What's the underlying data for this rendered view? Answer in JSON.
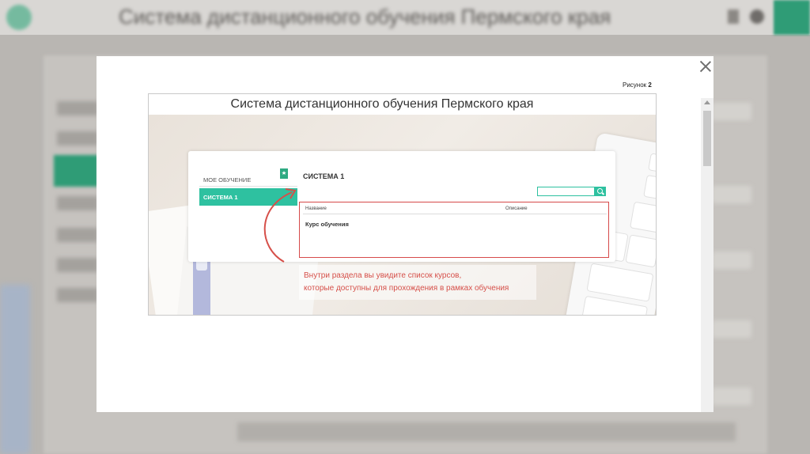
{
  "background": {
    "title": "Система дистанционного обучения Пермского края"
  },
  "modal": {
    "caption_prefix": "Рисунок",
    "caption_number": "2"
  },
  "slide": {
    "title": "Система дистанционного обучения Пермского края",
    "menu": {
      "my_learning": "МОЕ ОБУЧЕНИЕ",
      "active_item": "СИСТЕМА 1"
    },
    "section_title": "СИСТЕМА 1",
    "table": {
      "columns": [
        "Название",
        "Описание"
      ],
      "rows": [
        {
          "name": "Курс обучения"
        }
      ]
    },
    "note": [
      "Внутри раздела вы увидите список курсов,",
      "которые доступны для прохождения в рамках обучения"
    ]
  },
  "colors": {
    "accent": "#2ec1a0",
    "highlight": "#d64a4a"
  },
  "icons": [
    "close-icon",
    "bookmark-icon",
    "search-icon"
  ]
}
